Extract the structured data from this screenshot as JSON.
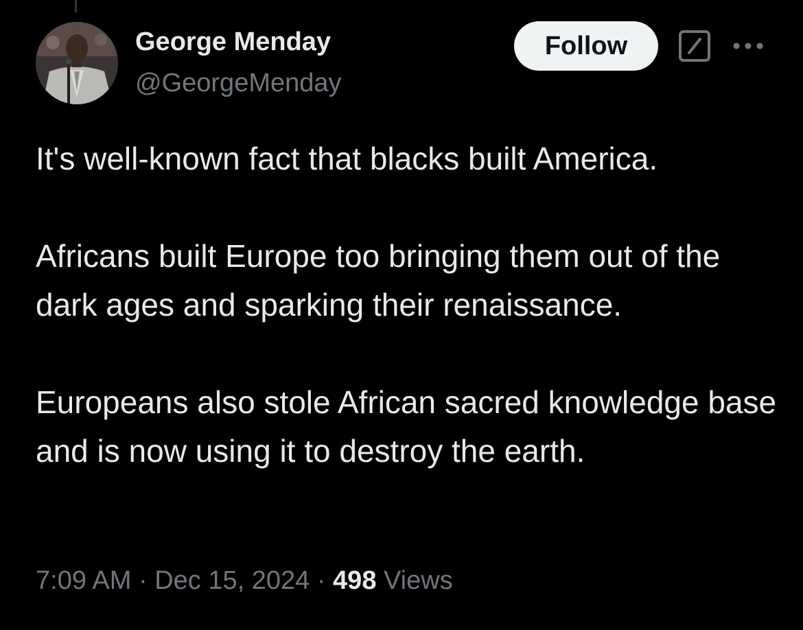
{
  "author": {
    "display_name": "George Menday",
    "handle": "@GeorgeMenday"
  },
  "actions": {
    "follow_label": "Follow",
    "grok_icon": "grok-slash-icon",
    "more_icon": "more-dots-icon"
  },
  "tweet": {
    "paragraphs": [
      "It's well-known fact that blacks built America.",
      "Africans built Europe too bringing them out of the dark ages and sparking their renaissance.",
      "Europeans also stole African sacred knowledge base and is now using it to destroy the earth."
    ]
  },
  "meta": {
    "time": "7:09 AM",
    "separator": "·",
    "date": "Dec 15, 2024",
    "views_count": "498",
    "views_label": "Views"
  },
  "colors": {
    "background": "#000000",
    "primary_text": "#e7e9ea",
    "secondary_text": "#71767b",
    "follow_bg": "#eff3f4",
    "follow_text": "#0f1419"
  }
}
